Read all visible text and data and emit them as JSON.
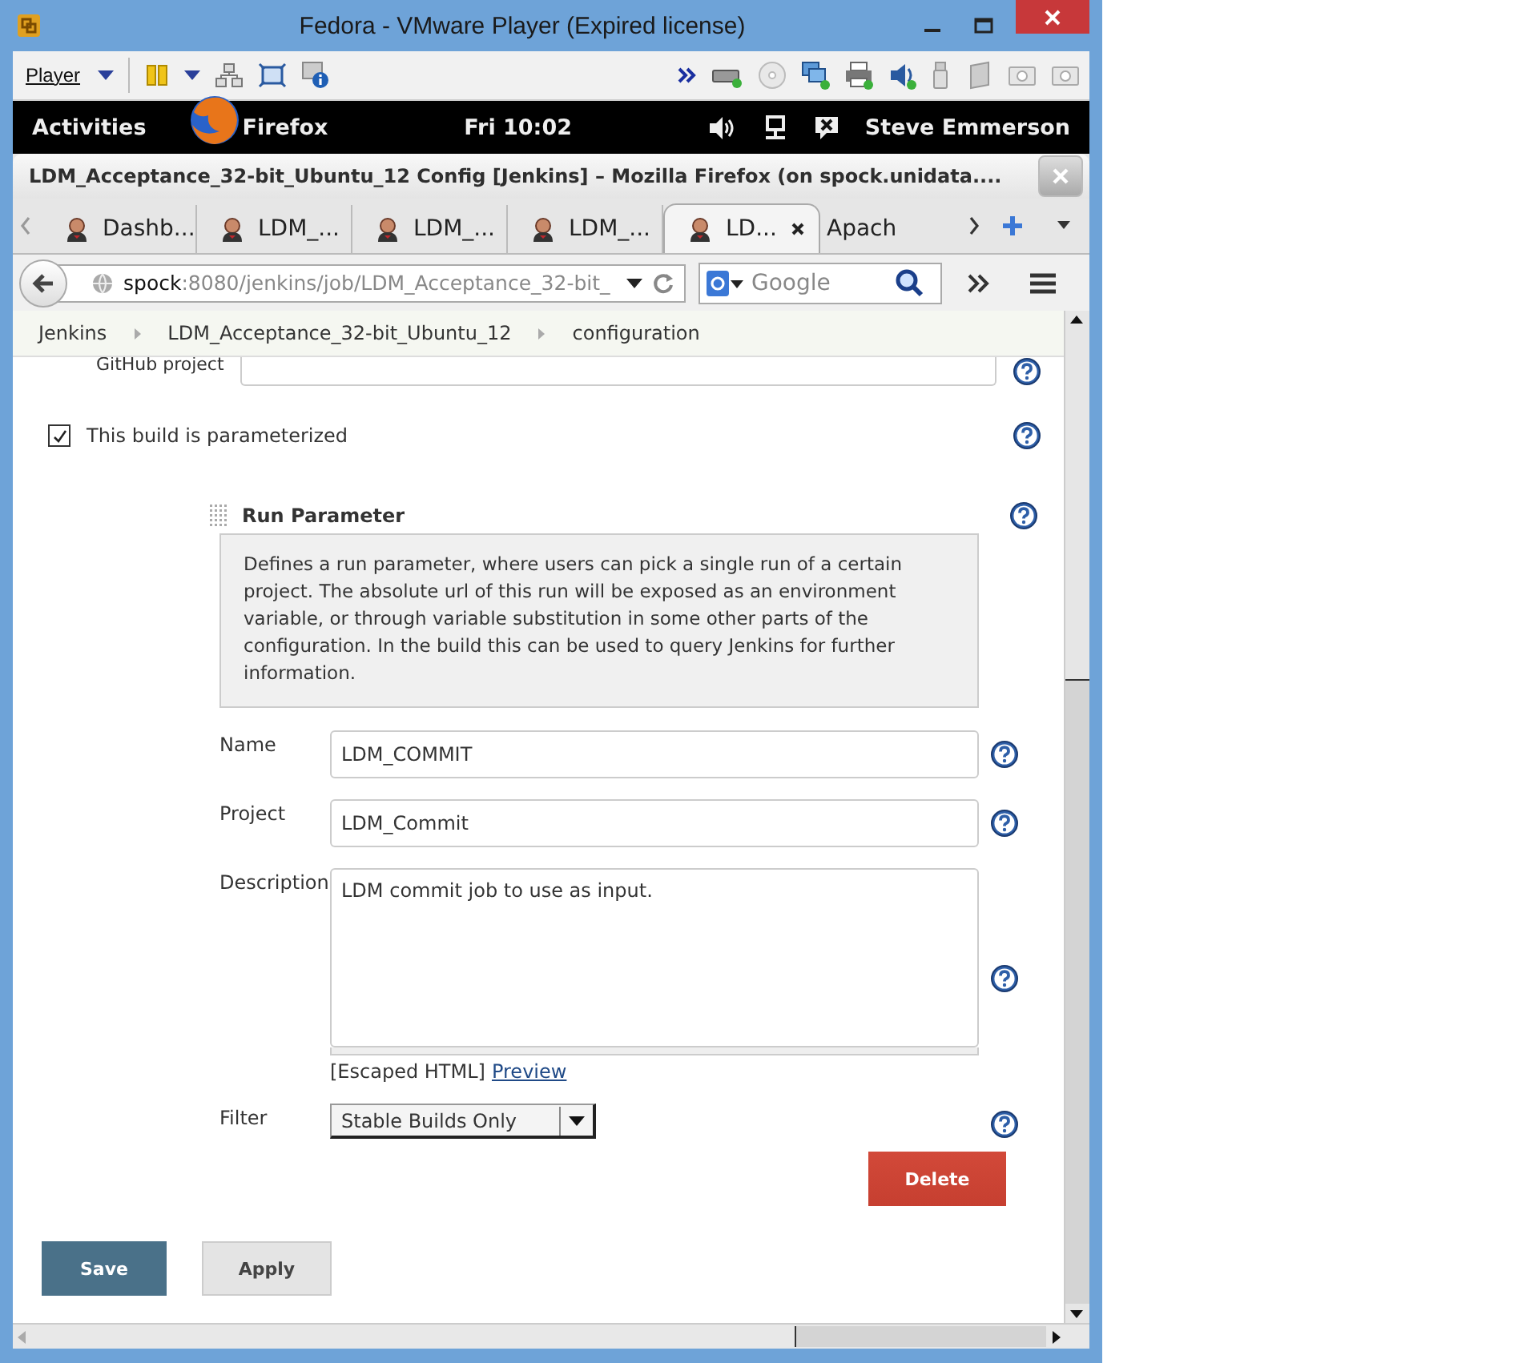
{
  "window": {
    "title": "Fedora - VMware Player (Expired license)"
  },
  "player_toolbar": {
    "menu": "Player"
  },
  "gnome_bar": {
    "activities": "Activities",
    "app": "Firefox",
    "clock": "Fri 10:02",
    "user": "Steve Emmerson"
  },
  "browser": {
    "title": "LDM_Acceptance_32-bit_Ubuntu_12 Config [Jenkins] – Mozilla Firefox (on spock.unidata....",
    "tabs": [
      {
        "label": "Dashb...",
        "selected": false
      },
      {
        "label": "LDM_...",
        "selected": false
      },
      {
        "label": "LDM_...",
        "selected": false
      },
      {
        "label": "LDM_...",
        "selected": false
      },
      {
        "label": "LD...",
        "selected": true
      },
      {
        "label": "Apach",
        "selected": false
      }
    ],
    "url": {
      "host": "spock",
      "rest": ":8080/jenkins/job/LDM_Acceptance_32-bit_"
    },
    "search": {
      "placeholder": "Google"
    }
  },
  "breadcrumbs": [
    "Jenkins",
    "LDM_Acceptance_32-bit_Ubuntu_12",
    "configuration"
  ],
  "form": {
    "github_project": {
      "label": "GitHub project"
    },
    "parameterized": {
      "label": "This build is parameterized",
      "checked": true
    },
    "parameter": {
      "title": "Run Parameter",
      "help_text": "Defines a run parameter, where users can pick a single run of a certain project. The absolute url of this run will be exposed as an environment variable, or through variable substitution in some other parts of the configuration. In the build this can be used to query Jenkins for further information.",
      "fields": [
        {
          "kind": "text",
          "label": "Name",
          "value": "LDM_COMMIT"
        },
        {
          "kind": "text",
          "label": "Project",
          "value": "LDM_Commit"
        },
        {
          "kind": "textarea",
          "label": "Description",
          "value": "LDM commit job to use as input.",
          "note": "[Escaped HTML]",
          "link": "Preview"
        },
        {
          "kind": "select",
          "label": "Filter",
          "value": "Stable Builds Only"
        }
      ],
      "delete": "Delete"
    }
  },
  "buttons": [
    {
      "kind": "primary",
      "label": "Save"
    },
    {
      "kind": "secondary",
      "label": "Apply"
    }
  ]
}
